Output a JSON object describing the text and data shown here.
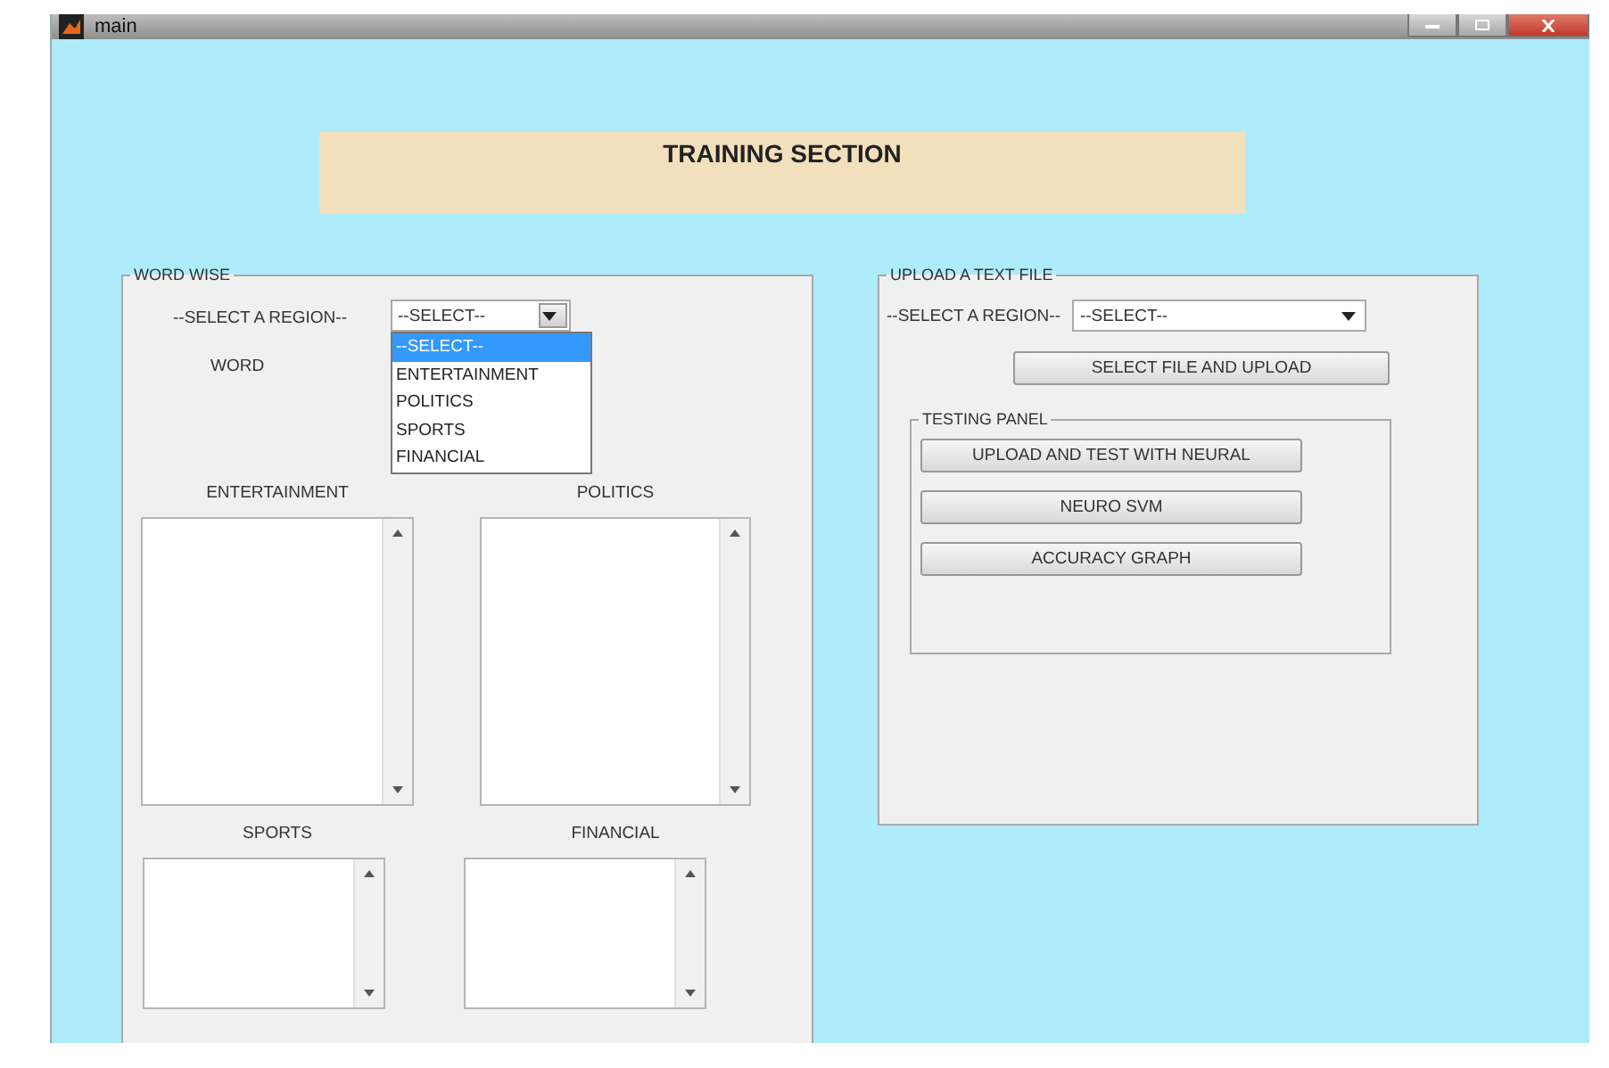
{
  "window": {
    "title": "main"
  },
  "banner": {
    "title": "TRAINING SECTION"
  },
  "word_wise": {
    "title": "WORD WISE",
    "region_label": "--SELECT A REGION--",
    "region_select": {
      "value": "--SELECT--",
      "expanded": true,
      "options": [
        {
          "label": "--SELECT--",
          "selected": true
        },
        {
          "label": "ENTERTAINMENT",
          "selected": false
        },
        {
          "label": "POLITICS",
          "selected": false
        },
        {
          "label": "SPORTS",
          "selected": false
        },
        {
          "label": "FINANCIAL",
          "selected": false
        }
      ]
    },
    "word_label": "WORD",
    "lists": [
      {
        "label": "ENTERTAINMENT"
      },
      {
        "label": "POLITICS"
      },
      {
        "label": "SPORTS"
      },
      {
        "label": "FINANCIAL"
      }
    ]
  },
  "upload": {
    "title": "UPLOAD A TEXT FILE",
    "region_label": "--SELECT A REGION--",
    "region_select": {
      "value": "--SELECT--",
      "expanded": false
    },
    "upload_button": "SELECT FILE AND UPLOAD",
    "testing_panel": {
      "title": "TESTING PANEL",
      "buttons": [
        "UPLOAD AND TEST WITH NEURAL",
        "NEURO SVM",
        "ACCURACY GRAPH"
      ]
    }
  }
}
